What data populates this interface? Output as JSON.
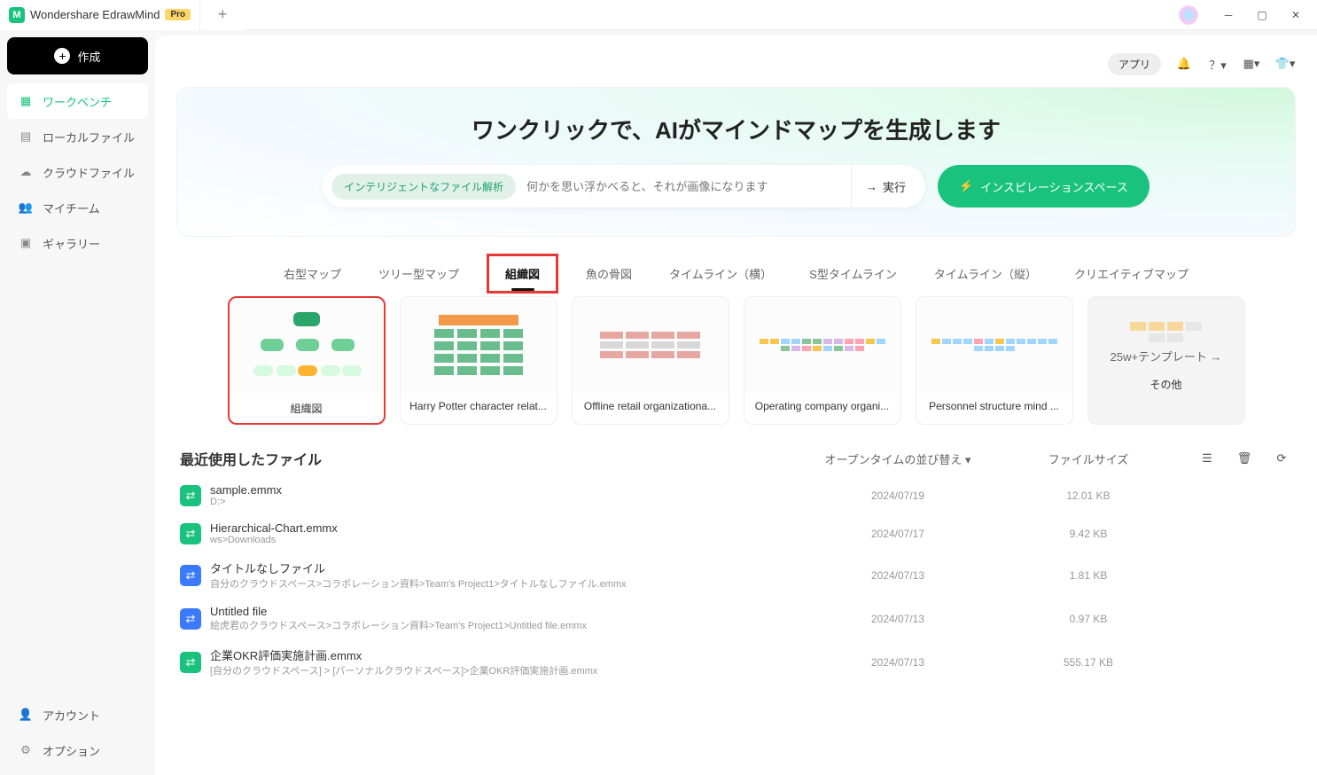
{
  "titlebar": {
    "app_name": "Wondershare EdrawMind",
    "badge": "Pro"
  },
  "sidebar": {
    "create_label": "作成",
    "items": [
      {
        "label": "ワークベンチ",
        "icon": "grid-icon",
        "active": true
      },
      {
        "label": "ローカルファイル",
        "icon": "folder-icon",
        "active": false
      },
      {
        "label": "クラウドファイル",
        "icon": "cloud-icon",
        "active": false
      },
      {
        "label": "マイチーム",
        "icon": "team-icon",
        "active": false
      },
      {
        "label": "ギャラリー",
        "icon": "gallery-icon",
        "active": false
      }
    ],
    "bottom": [
      {
        "label": "アカウント",
        "icon": "account-icon"
      },
      {
        "label": "オプション",
        "icon": "settings-icon"
      }
    ]
  },
  "topbar": {
    "app_button": "アプリ"
  },
  "hero": {
    "title": "ワンクリックで、AIがマインドマップを生成します",
    "pill": "インテリジェントなファイル解析",
    "placeholder": "何かを思い浮かべると、それが画像になります",
    "run_label": "実行",
    "inspire_label": "インスピレーションスペース"
  },
  "categories": [
    {
      "label": "右型マップ",
      "active": false
    },
    {
      "label": "ツリー型マップ",
      "active": false
    },
    {
      "label": "組織図",
      "active": true,
      "highlight": true
    },
    {
      "label": "魚の骨図",
      "active": false
    },
    {
      "label": "タイムライン（横）",
      "active": false
    },
    {
      "label": "S型タイムライン",
      "active": false
    },
    {
      "label": "タイムライン（縦）",
      "active": false
    },
    {
      "label": "クリエイティブマップ",
      "active": false
    }
  ],
  "templates": [
    {
      "label": "組織図",
      "highlight": true
    },
    {
      "label": "Harry Potter character relat..."
    },
    {
      "label": "Offline retail organizationa..."
    },
    {
      "label": "Operating company organi..."
    },
    {
      "label": "Personnel structure mind ..."
    }
  ],
  "more_card": {
    "count_label": "25w+テンプレート",
    "other_label": "その他"
  },
  "recent": {
    "heading": "最近使用したファイル",
    "sort_label": "オープンタイムの並び替え",
    "size_label": "ファイルサイズ",
    "files": [
      {
        "name": "sample.emmx",
        "path": "D:>",
        "date": "2024/07/19",
        "size": "12.01 KB",
        "color": "green"
      },
      {
        "name": "Hierarchical-Chart.emmx",
        "path": "ws>Downloads",
        "date": "2024/07/17",
        "size": "9.42 KB",
        "color": "green"
      },
      {
        "name": "タイトルなしファイル",
        "path": "自分のクラウドスペース>コラボレーション資料>Team's Project1>タイトルなしファイル.emmx",
        "date": "2024/07/13",
        "size": "1.81 KB",
        "color": "blue"
      },
      {
        "name": "Untitled file",
        "path": "絵虎君のクラウドスペース>コラボレーション資料>Team's Project1>Untitled file.emmx",
        "date": "2024/07/13",
        "size": "0.97 KB",
        "color": "blue"
      },
      {
        "name": "企業OKR評価実施計画.emmx",
        "path": "[自分のクラウドスペース] > [パーソナルクラウドスペース]>企業OKR評価実施計画.emmx",
        "date": "2024/07/13",
        "size": "555.17 KB",
        "color": "green"
      }
    ]
  }
}
